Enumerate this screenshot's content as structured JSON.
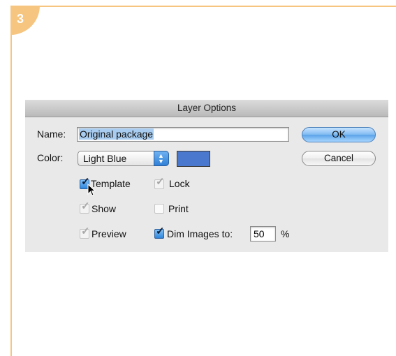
{
  "step": {
    "number": "3"
  },
  "dialog": {
    "title": "Layer Options",
    "name": {
      "label": "Name:",
      "value": "Original package"
    },
    "color": {
      "label": "Color:",
      "selected": "Light Blue",
      "swatch_color": "#4a78cf"
    },
    "buttons": {
      "ok": "OK",
      "cancel": "Cancel"
    },
    "options": {
      "template": {
        "label": "Template",
        "checked": true,
        "enabled": true
      },
      "lock": {
        "label": "Lock",
        "checked": true,
        "enabled": false
      },
      "show": {
        "label": "Show",
        "checked": true,
        "enabled": false
      },
      "print": {
        "label": "Print",
        "checked": false,
        "enabled": false
      },
      "preview": {
        "label": "Preview",
        "checked": true,
        "enabled": false
      },
      "dim_images": {
        "label": "Dim Images to:",
        "checked": true,
        "enabled": true,
        "value": "50",
        "unit": "%"
      }
    }
  },
  "colors": {
    "accent": "#f6c57f",
    "dialog_bg": "#e9e9e9",
    "ok_button": "#7fbaf2"
  }
}
